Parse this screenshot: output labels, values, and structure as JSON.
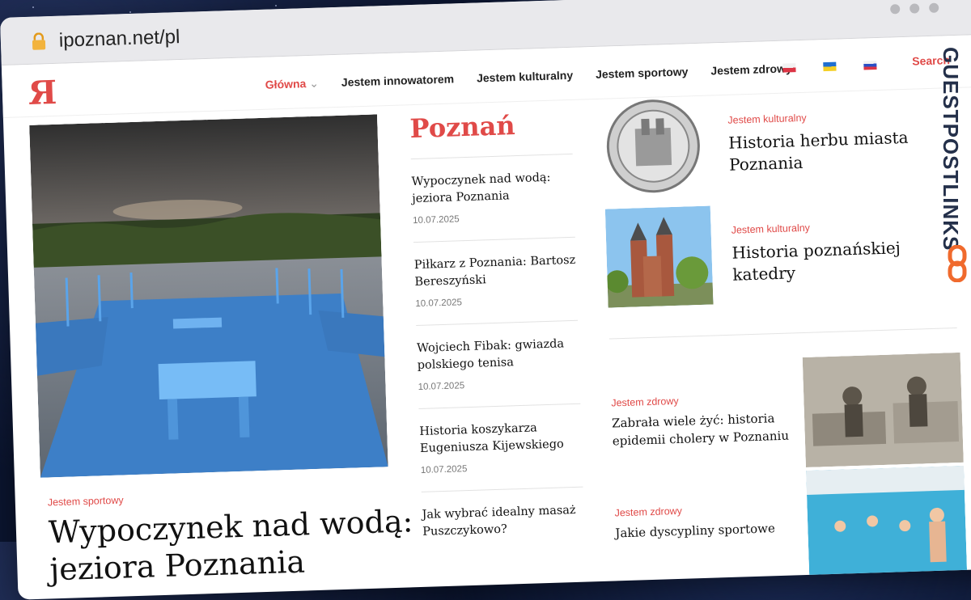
{
  "browser": {
    "url": "ipoznan.net/pl"
  },
  "nav": {
    "logo": "Я",
    "items": [
      {
        "label": "Główna"
      },
      {
        "label": "Jestem innowatorem"
      },
      {
        "label": "Jestem kulturalny"
      },
      {
        "label": "Jestem sportowy"
      },
      {
        "label": "Jestem zdrowy"
      }
    ],
    "search_label": "Search"
  },
  "hero": {
    "category": "Jestem sportowy",
    "title": "Wypoczynek nad wodą: jeziora Poznania"
  },
  "section": {
    "title": "Poznań",
    "items": [
      {
        "title": "Wypoczynek nad wodą: jeziora Poznania",
        "date": "10.07.2025"
      },
      {
        "title": "Piłkarz z Poznania: Bartosz Bereszyński",
        "date": "10.07.2025"
      },
      {
        "title": "Wojciech Fibak: gwiazda polskiego tenisa",
        "date": "10.07.2025"
      },
      {
        "title": "Historia koszykarza Eugeniusza Kijewskiego",
        "date": "10.07.2025"
      },
      {
        "title": "Jak wybrać idealny masaż Puszczykowo?",
        "date": ""
      }
    ]
  },
  "featured": [
    {
      "category": "Jestem kulturalny",
      "title": "Historia herbu miasta Poznania"
    },
    {
      "category": "Jestem kulturalny",
      "title": "Historia poznańskiej katedry"
    }
  ],
  "health": [
    {
      "category": "Jestem zdrowy",
      "title": "Zabrała wiele żyć: historia epidemii cholery w Poznaniu"
    },
    {
      "category": "Jestem zdrowy",
      "title": "Jakie dyscypliny sportowe"
    }
  ],
  "watermark": {
    "text": "GUESTPOSTLINKS"
  },
  "colors": {
    "accent": "#e04a48",
    "background": "#0b1530"
  }
}
